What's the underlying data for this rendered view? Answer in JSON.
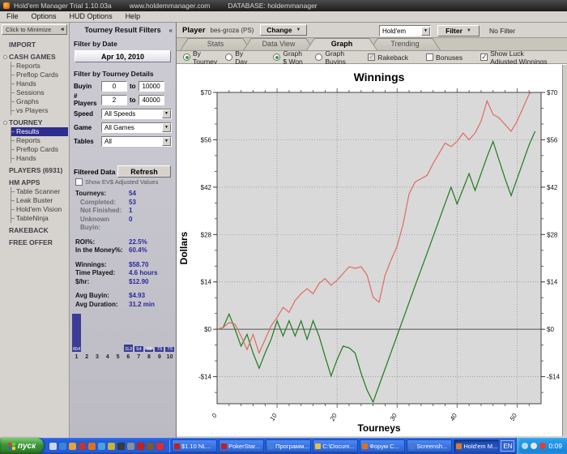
{
  "title_bar": {
    "title": "Hold'em Manager Trial 1.10.03a",
    "url": "www.holdemmanager.com",
    "database": "DATABASE: holdemmanager"
  },
  "menu": [
    "File",
    "Options",
    "HUD Options",
    "Help"
  ],
  "icons": {
    "collapse_left": "◄",
    "collapse_double": "«",
    "dropdown": "▼"
  },
  "sidebar": {
    "minimize_label": "Click to Minimize",
    "sections": [
      {
        "label": "IMPORT",
        "bullet": false,
        "items": []
      },
      {
        "label": "CASH GAMES",
        "bullet": true,
        "items": [
          "Reports",
          "Preflop Cards",
          "Hands",
          "Sessions",
          "Graphs",
          "vs Players"
        ]
      },
      {
        "label": "TOURNEY",
        "bullet": true,
        "items": [
          "Results",
          "Reports",
          "Preflop Cards",
          "Hands"
        ],
        "selected": "Results"
      },
      {
        "label": "PLAYERS (6931)",
        "bullet": false,
        "items": []
      },
      {
        "label": "HM APPS",
        "bullet": false,
        "items": [
          "Table Scanner",
          "Leak Buster",
          "Hold'em Vision",
          "TableNinja"
        ]
      },
      {
        "label": "RAKEBACK",
        "bullet": false,
        "items": []
      },
      {
        "label": "FREE OFFER",
        "bullet": false,
        "items": []
      }
    ]
  },
  "filters": {
    "header": "Tourney Result Filters",
    "date_section_label": "Filter by Date",
    "date_value": "Apr 10, 2010",
    "details_section_label": "Filter by Tourney Details",
    "rows": [
      {
        "type": "range",
        "label": "Buyin",
        "from": "0",
        "to_word": "to",
        "to": "10000"
      },
      {
        "type": "range",
        "label": "# Players",
        "from": "2",
        "to_word": "to",
        "to": "40000"
      },
      {
        "type": "select",
        "label": "Speed",
        "value": "All Speeds"
      },
      {
        "type": "select",
        "label": "Game",
        "value": "All Games"
      },
      {
        "type": "select",
        "label": "Tables",
        "value": "All"
      }
    ],
    "refresh_label": "Refresh"
  },
  "filtered_data": {
    "header": "Filtered Data",
    "ev_checkbox_label": "Show EV$ Adjusted Values",
    "stats": [
      {
        "label": "Tourneys:",
        "value": "54"
      },
      {
        "label": "Completed:",
        "value": "53",
        "indent": true
      },
      {
        "label": "Not Finished:",
        "value": "1",
        "indent": true
      },
      {
        "label": "Unknown Buyin:",
        "value": "0",
        "indent": true
      },
      {
        "gap": true
      },
      {
        "label": "ROI%:",
        "value": "22.5%"
      },
      {
        "label": "In the Money%:",
        "value": "60.4%"
      },
      {
        "gap": true
      },
      {
        "label": "Winnings:",
        "value": "$58.70"
      },
      {
        "label": "Time Played:",
        "value": "4.6 hours"
      },
      {
        "label": "$/hr:",
        "value": "$12.90"
      },
      {
        "gap": true
      },
      {
        "label": "Avg Buyin:",
        "value": "$4.93"
      },
      {
        "label": "Avg Duration:",
        "value": "31.2 min"
      }
    ]
  },
  "player_bar": {
    "label": "Player",
    "name": "bes-groza (PS)",
    "change_label": "Change",
    "game_value": "Hold'em",
    "filter_label": "Filter",
    "no_filter_label": "No Filter"
  },
  "tabs": [
    {
      "label": "Stats",
      "active": false
    },
    {
      "label": "Data View",
      "active": false
    },
    {
      "label": "Graph",
      "active": true
    },
    {
      "label": "Trending",
      "active": false
    }
  ],
  "graph_options": {
    "radios": [
      {
        "label": "By Tourney",
        "checked": true,
        "group": "x-mode"
      },
      {
        "label": "By Day",
        "checked": false,
        "group": "x-mode"
      },
      {
        "label": "Graph $ Won",
        "checked": true,
        "group": "y-mode"
      },
      {
        "label": "Graph Buyins",
        "checked": false,
        "group": "y-mode"
      }
    ],
    "checkboxes": [
      {
        "label": "Rakeback",
        "checked": true,
        "grayed": true
      },
      {
        "label": "Bonuses",
        "checked": false,
        "grayed": false
      },
      {
        "label": "Show Luck Adjusted Winnings",
        "checked": true,
        "grayed": false
      }
    ]
  },
  "chart_data": [
    {
      "type": "line",
      "title": "Winnings",
      "xlabel": "Tourneys",
      "ylabel": "Dollars",
      "xlim": [
        0,
        54
      ],
      "ylim": [
        -22,
        70
      ],
      "grid": "dotted",
      "legend": "none",
      "x_ticks": [
        {
          "v": 0,
          "label": "0"
        },
        {
          "v": 10,
          "label": "10"
        },
        {
          "v": 20,
          "label": "20"
        },
        {
          "v": 30,
          "label": "30"
        },
        {
          "v": 40,
          "label": "40"
        },
        {
          "v": 50,
          "label": "50"
        }
      ],
      "y_ticks": [
        {
          "v": 70,
          "label": "$70"
        },
        {
          "v": 56,
          "label": "$56"
        },
        {
          "v": 42,
          "label": "$42"
        },
        {
          "v": 28,
          "label": "$28"
        },
        {
          "v": 14,
          "label": "$14"
        },
        {
          "v": 0,
          "label": "$0"
        },
        {
          "v": -14,
          "label": "-$14"
        }
      ],
      "zero_line": 0,
      "series": [
        {
          "name": "$ Won",
          "color": "#1e7a1e",
          "values": [
            0,
            0.5,
            4.5,
            0,
            -5,
            -1.5,
            -7,
            -11.5,
            -7,
            -3,
            2.5,
            -2,
            2.5,
            -2,
            2.5,
            -3,
            2.5,
            -2,
            -8,
            -13.8,
            -9,
            -5,
            -5.5,
            -7,
            -13,
            -18,
            -21.5,
            -16.6,
            -11.7,
            -6.8,
            -1.9,
            3,
            7.9,
            12.8,
            17.7,
            22.5,
            27.4,
            32.3,
            37.2,
            42,
            37,
            41.5,
            46,
            41,
            46,
            51,
            55.5,
            50,
            44.5,
            39.5,
            44.5,
            49.5,
            54.5,
            58.5
          ]
        },
        {
          "name": "Luck Adjusted Winnings",
          "color": "#e06b63",
          "values": [
            0,
            0.5,
            2,
            1.5,
            -2,
            -6,
            -1.5,
            -7,
            -3,
            1,
            3.5,
            6.5,
            5,
            8.5,
            10.5,
            12,
            10.5,
            13.5,
            15,
            13,
            14.5,
            16.5,
            18.5,
            18,
            18.5,
            16,
            9.5,
            8,
            16,
            20.5,
            24.5,
            31,
            40,
            43.5,
            44.5,
            45.5,
            49,
            52,
            55,
            54,
            55.5,
            58,
            56,
            58,
            61.5,
            67.5,
            63.5,
            62.5,
            60.5,
            58.5,
            61.5,
            65.5,
            69.5,
            71
          ]
        }
      ]
    },
    {
      "type": "bar",
      "title": "",
      "categories": [
        "1",
        "2",
        "3",
        "4",
        "5",
        "6",
        "7",
        "8",
        "9",
        "10"
      ],
      "values": [
        60.4,
        0,
        0,
        0,
        0,
        11.3,
        9.4,
        3.8,
        7.5,
        7.5
      ],
      "value_labels": [
        "60.4",
        "",
        "",
        "",
        "",
        "11.3",
        "9.4",
        "3.8",
        "7.5",
        "7.5"
      ],
      "bar_color": "#3c3c96"
    }
  ],
  "taskbar": {
    "start_label": "пуск",
    "quicklaunch": [
      {
        "name": "show-desktop-icon",
        "color": "#cdd6e8"
      },
      {
        "name": "browser-icon",
        "color": "#3f83d6"
      },
      {
        "name": "media-player-icon",
        "color": "#e8a23c"
      },
      {
        "name": "messenger-icon",
        "color": "#b33a3a"
      },
      {
        "name": "firefox-icon",
        "color": "#e07020"
      },
      {
        "name": "explorer-icon",
        "color": "#4aa0e0"
      },
      {
        "name": "winamp-icon",
        "color": "#c8b23c"
      },
      {
        "name": "music-icon",
        "color": "#3a3a3a"
      },
      {
        "name": "office-icon",
        "color": "#8a8f96"
      },
      {
        "name": "pokerstars-icon",
        "color": "#c22020"
      },
      {
        "name": "briefcase-icon",
        "color": "#7a5a30"
      },
      {
        "name": "star-icon",
        "color": "#d83030"
      }
    ],
    "buttons": [
      {
        "label": "$1.10 NL...",
        "icon": "pokerstars-table-icon",
        "icon_color": "#c22020",
        "active": false
      },
      {
        "label": "PokerStar...",
        "icon": "pokerstars-icon",
        "icon_color": "#c22020",
        "active": false
      },
      {
        "label": "Программ...",
        "icon": "ie-icon",
        "icon_color": "#3f83d6",
        "active": false
      },
      {
        "label": "C:\\Docum...",
        "icon": "folder-icon",
        "icon_color": "#e8c23c",
        "active": false
      },
      {
        "label": "Форум С...",
        "icon": "firefox-icon",
        "icon_color": "#e07020",
        "active": false
      },
      {
        "label": "Screensh...",
        "icon": "image-icon",
        "icon_color": "#4a78c8",
        "active": false
      },
      {
        "label": "Hold'em M...",
        "icon": "holdem-manager-icon",
        "icon_color": "#e07a20",
        "active": true
      }
    ],
    "lang_indicator": "EN",
    "tray_icons": [
      {
        "name": "network-icon",
        "color": "#bcd8f0"
      },
      {
        "name": "volume-icon",
        "color": "#e8e8e8"
      },
      {
        "name": "update-icon",
        "color": "#e04030"
      }
    ],
    "clock": "0:09"
  }
}
